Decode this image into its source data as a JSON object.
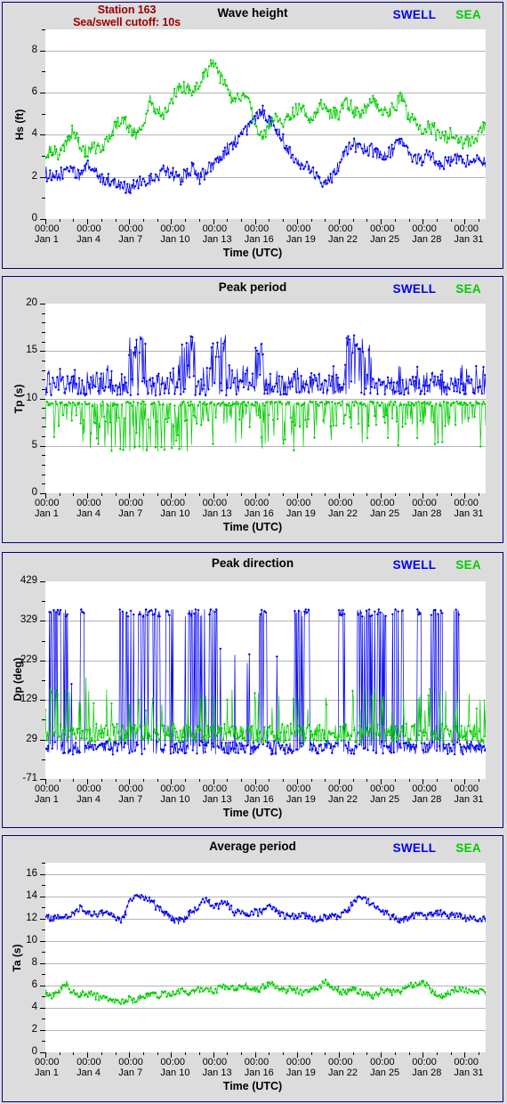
{
  "meta": {
    "station_label": "Station 163",
    "cutoff_label": "Sea/swell cutoff: 10s",
    "station_color": "#990000",
    "swell_color": "#0000ee",
    "sea_color": "#00cc00",
    "background": "#dcdcdc",
    "border_color": "#000080"
  },
  "legend": {
    "swell": "SWELL",
    "sea": "SEA"
  },
  "xaxis": {
    "title": "Time (UTC)",
    "tick_times": [
      "00:00",
      "00:00",
      "00:00",
      "00:00",
      "00:00",
      "00:00",
      "00:00",
      "00:00",
      "00:00",
      "00:00",
      "00:00"
    ],
    "tick_dates": [
      "Jan 1",
      "Jan 4",
      "Jan 7",
      "Jan 10",
      "Jan 13",
      "Jan 16",
      "Jan 19",
      "Jan 22",
      "Jan 25",
      "Jan 28",
      "Jan 31"
    ],
    "range_days": [
      0,
      31.5
    ],
    "minor_interval_days": 1,
    "major_interval_days": 3
  },
  "panels": [
    {
      "id": "wave-height",
      "title": "Wave height",
      "ylabel": "Hs (ft)",
      "yticks": [
        "0",
        "2",
        "4",
        "6",
        "8"
      ],
      "ylim": [
        0,
        9
      ],
      "minor_ticks_per_major": 2
    },
    {
      "id": "peak-period",
      "title": "Peak period",
      "ylabel": "Tp (s)",
      "yticks": [
        "0",
        "5",
        "10",
        "15",
        "20"
      ],
      "ylim": [
        0,
        20
      ],
      "minor_ticks_per_major": 5
    },
    {
      "id": "peak-direction",
      "title": "Peak direction",
      "ylabel": "Dp (deg)",
      "yticks": [
        "-71",
        "29",
        "129",
        "229",
        "329",
        "429"
      ],
      "ylim": [
        -71,
        429
      ],
      "minor_ticks_per_major": 2
    },
    {
      "id": "average-period",
      "title": "Average period",
      "ylabel": "Ta (s)",
      "yticks": [
        "0",
        "2",
        "4",
        "6",
        "8",
        "10",
        "12",
        "14",
        "16"
      ],
      "ylim": [
        0,
        17
      ],
      "minor_ticks_per_major": 2
    }
  ],
  "chart_data": [
    {
      "type": "line",
      "title": "Wave height",
      "xlabel": "Time (UTC)",
      "ylabel": "Hs (ft)",
      "ylim": [
        0,
        9
      ],
      "xlim_days": [
        0,
        31.5
      ],
      "grid": true,
      "legend_position": "top-right",
      "series": [
        {
          "name": "SWELL",
          "color": "#0000ee",
          "x_days": [
            0,
            0.5,
            1,
            1.5,
            2,
            2.5,
            3,
            3.5,
            4,
            4.5,
            5,
            5.5,
            6,
            6.5,
            7,
            7.5,
            8,
            8.5,
            9,
            9.5,
            10,
            10.5,
            11,
            11.5,
            12,
            12.5,
            13,
            13.5,
            14,
            14.5,
            15,
            15.5,
            16,
            16.5,
            17,
            17.5,
            18,
            18.5,
            19,
            19.5,
            20,
            20.5,
            21,
            21.5,
            22,
            22.5,
            23,
            23.5,
            24,
            24.5,
            25,
            25.5,
            26,
            26.5,
            27,
            27.5,
            28,
            28.5,
            29,
            29.5,
            30,
            30.5,
            31,
            31.5
          ],
          "values": [
            2.2,
            1.9,
            2.0,
            2.4,
            2.3,
            2.0,
            2.6,
            2.3,
            1.9,
            1.8,
            1.7,
            1.6,
            1.5,
            1.6,
            1.7,
            1.8,
            2.0,
            2.3,
            2.2,
            1.9,
            2.1,
            2.4,
            2.0,
            2.2,
            2.6,
            3.0,
            3.3,
            3.6,
            4.0,
            4.4,
            4.7,
            5.2,
            4.8,
            4.3,
            3.7,
            3.2,
            2.8,
            2.6,
            2.3,
            2.0,
            1.8,
            2.0,
            2.6,
            3.3,
            3.6,
            3.4,
            3.3,
            3.2,
            2.9,
            3.1,
            3.4,
            3.7,
            3.1,
            2.8,
            2.9,
            3.0,
            2.7,
            2.6,
            2.8,
            2.9,
            2.7,
            2.8,
            3.1,
            2.6
          ]
        },
        {
          "name": "SEA",
          "color": "#00cc00",
          "x_days": [
            0,
            0.5,
            1,
            1.5,
            2,
            2.5,
            3,
            3.5,
            4,
            4.5,
            5,
            5.5,
            6,
            6.5,
            7,
            7.5,
            8,
            8.5,
            9,
            9.5,
            10,
            10.5,
            11,
            11.5,
            12,
            12.5,
            13,
            13.5,
            14,
            14.5,
            15,
            15.5,
            16,
            16.5,
            17,
            17.5,
            18,
            18.5,
            19,
            19.5,
            20,
            20.5,
            21,
            21.5,
            22,
            22.5,
            23,
            23.5,
            24,
            24.5,
            25,
            25.5,
            26,
            26.5,
            27,
            27.5,
            28,
            28.5,
            29,
            29.5,
            30,
            30.5,
            31,
            31.5
          ],
          "values": [
            3.1,
            3.3,
            3.0,
            3.6,
            4.2,
            3.4,
            3.2,
            3.5,
            3.3,
            3.8,
            4.4,
            4.7,
            4.3,
            4.0,
            4.6,
            5.6,
            5.2,
            5.0,
            5.6,
            6.1,
            6.2,
            6.0,
            6.4,
            7.0,
            7.5,
            6.8,
            6.2,
            5.6,
            5.9,
            6.0,
            4.2,
            3.8,
            4.4,
            4.9,
            4.6,
            4.8,
            5.2,
            5.0,
            4.7,
            5.2,
            5.4,
            4.9,
            5.0,
            5.6,
            5.2,
            4.8,
            5.3,
            5.6,
            5.1,
            5.0,
            5.4,
            5.8,
            4.8,
            4.5,
            4.2,
            4.4,
            4.1,
            3.9,
            4.0,
            3.8,
            3.6,
            3.7,
            4.0,
            4.5
          ]
        }
      ]
    },
    {
      "type": "line",
      "title": "Peak period",
      "xlabel": "Time (UTC)",
      "ylabel": "Tp (s)",
      "ylim": [
        0,
        20
      ],
      "xlim_days": [
        0,
        31.5
      ],
      "grid": true,
      "legend_position": "top-right",
      "series": [
        {
          "name": "SWELL",
          "color": "#0000ee",
          "note": "Noisy band mostly 10.5-13.5 s with spikes to 16.5 s near Jan 6-7, Jan 10, Jan 22-23",
          "band": [
            10.4,
            13.5
          ],
          "spike_max": 16.7
        },
        {
          "name": "SEA",
          "color": "#00cc00",
          "note": "Dense band pinned at ~9.8 s with frequent downward excursions to 4.5-8 s",
          "band": [
            8.5,
            9.9
          ],
          "spike_min": 4.5
        }
      ]
    },
    {
      "type": "line",
      "title": "Peak direction",
      "xlabel": "Time (UTC)",
      "ylabel": "Dp (deg)",
      "ylim": [
        -71,
        429
      ],
      "xlim_days": [
        0,
        31.5
      ],
      "grid": true,
      "legend_position": "top-right",
      "series": [
        {
          "name": "SWELL",
          "color": "#0000ee",
          "note": "Mostly near 0-20 deg with frequent full-range wrap spikes to ~355 deg",
          "band": [
            -5,
            30
          ],
          "spike_max": 357
        },
        {
          "name": "SEA",
          "color": "#00cc00",
          "note": "Clustered 20-80 deg with occasional excursions to 130-180 deg and rare spikes to 355 deg",
          "band": [
            20,
            80
          ],
          "spike_max": 357
        }
      ]
    },
    {
      "type": "line",
      "title": "Average period",
      "xlabel": "Time (UTC)",
      "ylabel": "Ta (s)",
      "ylim": [
        0,
        17
      ],
      "xlim_days": [
        0,
        31.5
      ],
      "grid": true,
      "legend_position": "top-right",
      "series": [
        {
          "name": "SWELL",
          "color": "#0000ee",
          "x_days": [
            0,
            0.5,
            1,
            1.5,
            2,
            2.5,
            3,
            3.5,
            4,
            4.5,
            5,
            5.5,
            6,
            6.5,
            7,
            7.5,
            8,
            8.5,
            9,
            9.5,
            10,
            10.5,
            11,
            11.5,
            12,
            12.5,
            13,
            13.5,
            14,
            14.5,
            15,
            15.5,
            16,
            16.5,
            17,
            17.5,
            18,
            18.5,
            19,
            19.5,
            20,
            20.5,
            21,
            21.5,
            22,
            22.5,
            23,
            23.5,
            24,
            24.5,
            25,
            25.5,
            26,
            26.5,
            27,
            27.5,
            28,
            28.5,
            29,
            29.5,
            30,
            30.5,
            31,
            31.5
          ],
          "values": [
            12.1,
            12.0,
            12.2,
            12.1,
            12.4,
            12.9,
            12.5,
            12.3,
            12.5,
            12.4,
            12.2,
            11.9,
            13.4,
            14.1,
            13.9,
            13.6,
            13.0,
            12.4,
            12.0,
            11.8,
            12.1,
            12.5,
            13.2,
            13.8,
            13.0,
            13.3,
            13.4,
            12.6,
            12.4,
            12.3,
            12.5,
            12.6,
            13.2,
            12.8,
            12.3,
            12.1,
            12.2,
            12.4,
            12.0,
            11.9,
            12.1,
            12.3,
            12.2,
            12.6,
            13.3,
            14.1,
            13.6,
            13.2,
            12.8,
            12.4,
            12.0,
            11.8,
            12.1,
            12.4,
            12.3,
            12.2,
            12.5,
            12.4,
            12.3,
            12.2,
            12.1,
            12.0,
            12.0,
            11.9
          ]
        },
        {
          "name": "SEA",
          "color": "#00cc00",
          "x_days": [
            0,
            0.5,
            1,
            1.5,
            2,
            2.5,
            3,
            3.5,
            4,
            4.5,
            5,
            5.5,
            6,
            6.5,
            7,
            7.5,
            8,
            8.5,
            9,
            9.5,
            10,
            10.5,
            11,
            11.5,
            12,
            12.5,
            13,
            13.5,
            14,
            14.5,
            15,
            15.5,
            16,
            16.5,
            17,
            17.5,
            18,
            18.5,
            19,
            19.5,
            20,
            20.5,
            21,
            21.5,
            22,
            22.5,
            23,
            23.5,
            24,
            24.5,
            25,
            25.5,
            26,
            26.5,
            27,
            27.5,
            28,
            28.5,
            29,
            29.5,
            30,
            30.5,
            31,
            31.5
          ],
          "values": [
            5.2,
            5.0,
            5.6,
            6.1,
            5.4,
            5.2,
            5.3,
            5.1,
            4.9,
            4.7,
            4.6,
            4.5,
            4.8,
            4.6,
            4.9,
            5.2,
            5.0,
            5.3,
            5.1,
            5.4,
            5.5,
            5.3,
            5.7,
            5.6,
            5.4,
            5.8,
            5.9,
            5.7,
            5.8,
            6.0,
            5.6,
            5.8,
            6.1,
            5.7,
            5.5,
            5.8,
            5.6,
            5.4,
            5.7,
            5.9,
            6.2,
            5.8,
            5.5,
            5.3,
            5.7,
            5.4,
            5.2,
            5.0,
            5.4,
            5.6,
            5.3,
            5.5,
            6.2,
            6.0,
            6.4,
            5.8,
            5.2,
            5.0,
            5.4,
            5.6,
            5.5,
            5.3,
            5.6,
            5.4
          ]
        }
      ]
    }
  ]
}
